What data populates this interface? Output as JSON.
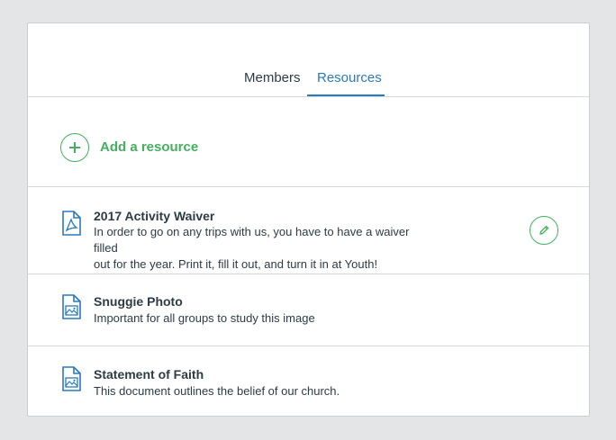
{
  "tabs": [
    {
      "label": "Members",
      "active": false
    },
    {
      "label": "Resources",
      "active": true
    }
  ],
  "add_resource": {
    "label": "Add a resource",
    "icon": "plus-circle-icon"
  },
  "resources": [
    {
      "title": "2017 Activity Waiver",
      "description_lines": [
        "In order to go on any trips with us, you have to have a waiver filled",
        "out for the year. Print it, fill it out, and turn it in at Youth!"
      ],
      "icon": "pdf-document-icon",
      "editable": true
    },
    {
      "title": "Snuggie Photo",
      "description_lines": [
        "Important for all groups to study this image"
      ],
      "icon": "image-document-icon",
      "editable": false
    },
    {
      "title": "Statement of Faith",
      "description_lines": [
        "This document outlines the belief of our church."
      ],
      "icon": "image-document-icon",
      "editable": false
    }
  ],
  "colors": {
    "accent_green": "#42b05f",
    "active_tab_blue": "#2b7abc",
    "text": "#2d3b45"
  }
}
